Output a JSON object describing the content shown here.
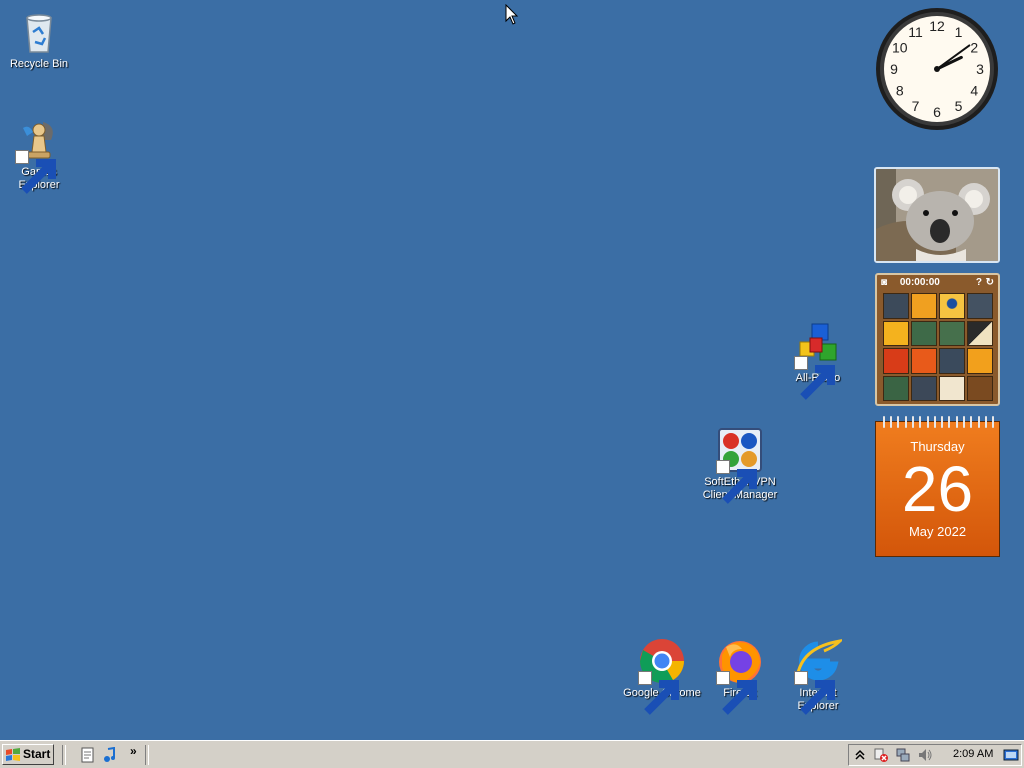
{
  "desktop_icons": {
    "recycle_bin": "Recycle Bin",
    "games_explorer": "Games\nExplorer",
    "all_radio": "All-Radio",
    "softether": "SoftEther VPN\nClient Manager",
    "chrome": "Google Chrome",
    "firefox": "Firefox",
    "ie": "Internet\nExplorer"
  },
  "gadgets": {
    "clock": {
      "hour": 2,
      "minute": 9,
      "numerals": [
        "12",
        "1",
        "2",
        "3",
        "4",
        "5",
        "6",
        "7",
        "8",
        "9",
        "10",
        "11"
      ]
    },
    "puzzle": {
      "timer": "00:00:00"
    },
    "calendar": {
      "day_of_week": "Thursday",
      "day": "26",
      "month_year": "May 2022"
    }
  },
  "taskbar": {
    "start_label": "Start",
    "chevron": "»",
    "clock": "2:09 AM"
  },
  "colors": {
    "desktop": "#3b6ea5",
    "taskbar": "#d4d0c8",
    "calendar": "#e8690f"
  }
}
